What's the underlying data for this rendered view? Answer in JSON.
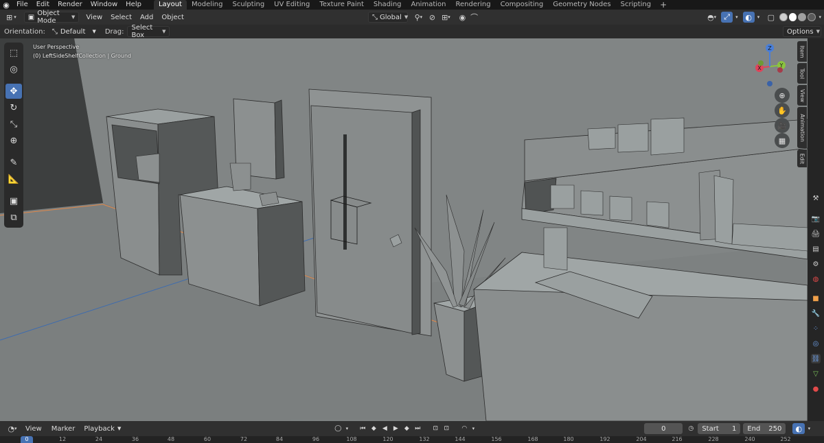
{
  "topbar": {
    "menus": [
      "File",
      "Edit",
      "Render",
      "Window",
      "Help"
    ],
    "workspaces": [
      "Layout",
      "Modeling",
      "Sculpting",
      "UV Editing",
      "Texture Paint",
      "Shading",
      "Animation",
      "Rendering",
      "Compositing",
      "Geometry Nodes",
      "Scripting"
    ],
    "active_workspace": "Layout",
    "add_tab": "+"
  },
  "view_header": {
    "mode": "Object Mode",
    "menus": [
      "View",
      "Select",
      "Add",
      "Object"
    ],
    "transform_orientation": "Global"
  },
  "tool_settings": {
    "orientation_label": "Orientation:",
    "orientation_value": "Default",
    "drag_label": "Drag:",
    "drag_value": "Select Box",
    "options_label": "Options"
  },
  "viewport": {
    "perspective": "User Perspective",
    "collection_info": "(0) LeftSideShelfCollection | Ground",
    "gizmo": {
      "x": "X",
      "y": "Y",
      "z": "Z"
    },
    "colors": {
      "x_axis": "#e0445a",
      "y_axis": "#8bc43f",
      "z_axis": "#4a7fd8",
      "accent": "#4772b3"
    }
  },
  "sidebar_tabs": [
    "Item",
    "Tool",
    "View",
    "Animation",
    "Edit"
  ],
  "timeline": {
    "menus": [
      "View",
      "Marker",
      "Playback"
    ],
    "current_frame": "0",
    "start_label": "Start",
    "start_value": "1",
    "end_label": "End",
    "end_value": "250"
  },
  "ruler": {
    "current": "0",
    "ticks": [
      "12",
      "24",
      "36",
      "48",
      "60",
      "72",
      "84",
      "96",
      "108",
      "120",
      "132",
      "144",
      "156",
      "168",
      "180",
      "192",
      "204",
      "216",
      "228",
      "240",
      "252"
    ]
  }
}
